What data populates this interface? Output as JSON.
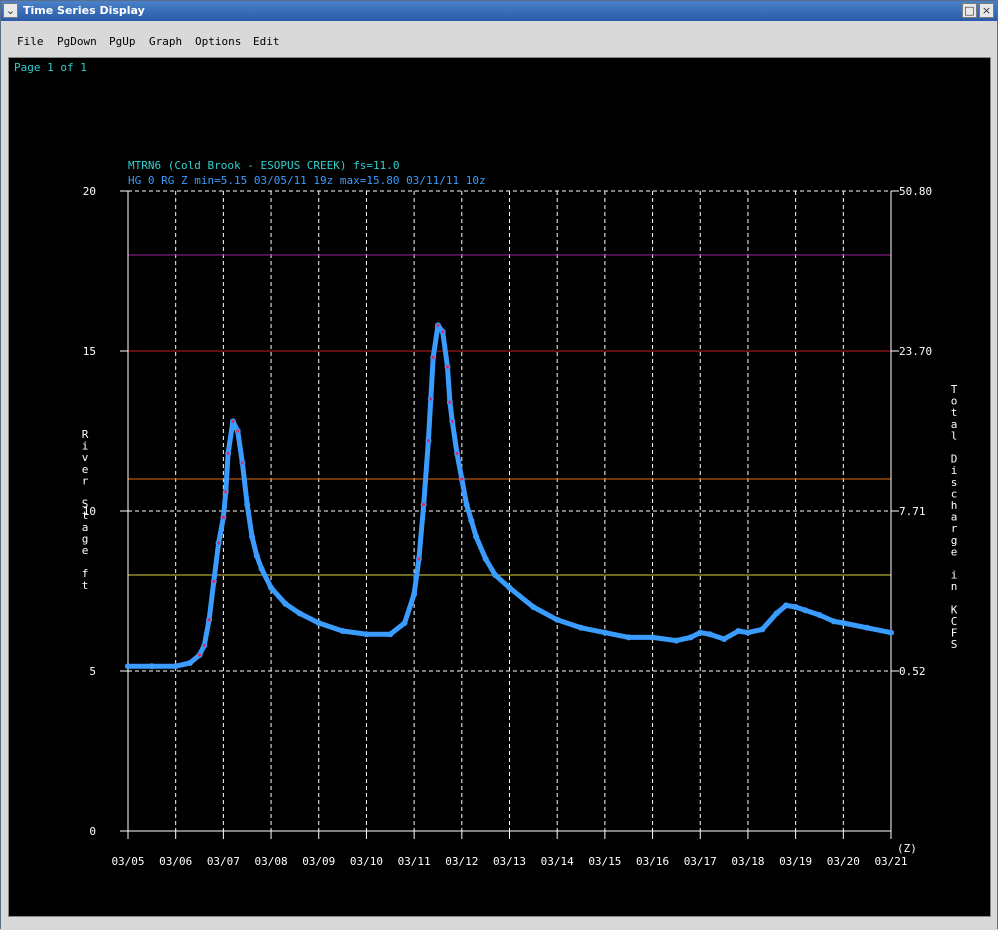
{
  "window": {
    "title": "Time Series Display"
  },
  "menu": [
    "File",
    "PgDown",
    "PgUp",
    "Graph",
    "Options",
    "Edit"
  ],
  "page_label": "Page 1 of 1",
  "chart_data": {
    "type": "line",
    "title": "MTRN6 (Cold Brook - ESOPUS CREEK) fs=11.0",
    "subtitle": "HG 0 RG Z min=5.15 03/05/11 19z max=15.80 03/11/11 10z",
    "ylabel": "River Stage ft",
    "y2label": "Total Discharge in KCFS",
    "xunit": "(Z)",
    "x_categories": [
      "03/05",
      "03/06",
      "03/07",
      "03/08",
      "03/09",
      "03/10",
      "03/11",
      "03/12",
      "03/13",
      "03/14",
      "03/15",
      "03/16",
      "03/17",
      "03/18",
      "03/19",
      "03/20",
      "03/21"
    ],
    "ylim": [
      0,
      20
    ],
    "y_ticks": [
      0,
      5,
      10,
      15,
      20
    ],
    "y_tick_labels": [
      "0",
      "5",
      "10",
      "15",
      "20"
    ],
    "y2_ticks": [
      5,
      10,
      15,
      20
    ],
    "y2_tick_labels": [
      "0.52",
      "7.71",
      "23.70",
      "50.80"
    ],
    "threshold_lines": [
      {
        "value": 18,
        "color": "#a020a0"
      },
      {
        "value": 15,
        "color": "#c81e1e"
      },
      {
        "value": 11,
        "color": "#e06a10"
      },
      {
        "value": 8,
        "color": "#d8d040"
      }
    ],
    "grid": true,
    "series": [
      {
        "color": "#3a9cff",
        "x": [
          0,
          0.5,
          1,
          1.3,
          1.5,
          1.6,
          1.7,
          1.8,
          1.9,
          2.0,
          2.05,
          2.1,
          2.2,
          2.3,
          2.4,
          2.5,
          2.6,
          2.7,
          2.8,
          3.0,
          3.3,
          3.6,
          4.0,
          4.5,
          5.0,
          5.5,
          5.8,
          6.0,
          6.1,
          6.2,
          6.3,
          6.35,
          6.4,
          6.5,
          6.6,
          6.7,
          6.75,
          6.8,
          6.9,
          7.0,
          7.1,
          7.2,
          7.3,
          7.5,
          7.7,
          8.0,
          8.5,
          9.0,
          9.5,
          10.0,
          10.5,
          11.0,
          11.5,
          11.8,
          12.0,
          12.2,
          12.5,
          12.8,
          13.0,
          13.3,
          13.6,
          13.8,
          14.0,
          14.2,
          14.5,
          14.8,
          15.0,
          15.5,
          16.0
        ],
        "y": [
          5.15,
          5.15,
          5.15,
          5.25,
          5.5,
          5.8,
          6.6,
          7.8,
          9.0,
          9.8,
          10.6,
          11.8,
          12.8,
          12.5,
          11.5,
          10.2,
          9.2,
          8.6,
          8.2,
          7.6,
          7.1,
          6.8,
          6.5,
          6.25,
          6.15,
          6.15,
          6.5,
          7.4,
          8.5,
          10.2,
          12.2,
          13.5,
          14.8,
          15.8,
          15.6,
          14.5,
          13.4,
          12.8,
          11.8,
          11.0,
          10.2,
          9.7,
          9.2,
          8.5,
          8.0,
          7.6,
          7.0,
          6.6,
          6.35,
          6.2,
          6.05,
          6.05,
          5.95,
          6.05,
          6.2,
          6.15,
          6.0,
          6.25,
          6.2,
          6.3,
          6.8,
          7.05,
          7.0,
          6.9,
          6.75,
          6.55,
          6.5,
          6.35,
          6.2
        ]
      },
      {
        "color": "#d2306a",
        "x": [
          1.5,
          1.6,
          1.7,
          1.8,
          1.9,
          2.0,
          2.05,
          2.1,
          2.2,
          2.3,
          2.4,
          6.1,
          6.2,
          6.3,
          6.35,
          6.4,
          6.5,
          6.6,
          6.7,
          6.75,
          6.8,
          6.9,
          7.0
        ],
        "y": [
          5.5,
          5.8,
          6.6,
          7.8,
          9.0,
          9.8,
          10.6,
          11.8,
          12.8,
          12.5,
          11.5,
          8.5,
          10.2,
          12.2,
          13.5,
          14.8,
          15.8,
          15.6,
          14.5,
          13.4,
          12.8,
          11.8,
          11.0
        ]
      }
    ]
  }
}
